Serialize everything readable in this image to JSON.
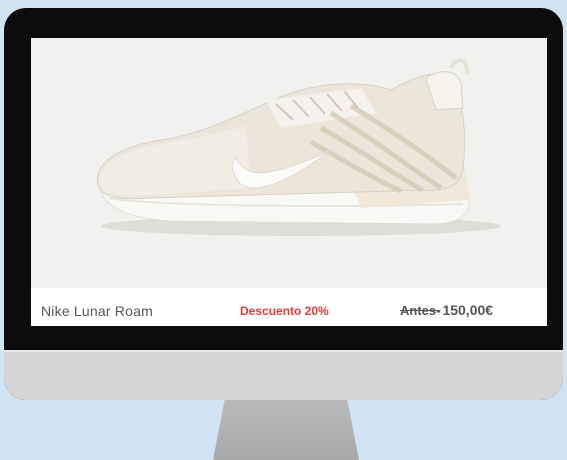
{
  "product": {
    "name": "Nike Lunar Roam",
    "discount_label": "Descuento 20%",
    "price_prefix": "Antes-",
    "price_value": "150,00€"
  },
  "colors": {
    "background": "#d2e3f3",
    "bezel": "#0c0c0c",
    "chin": "#d6d6d6",
    "stand": "#b0b0b0",
    "discount": "#e43a3a",
    "text": "#555555"
  },
  "icons": {
    "product_image": "sneaker-icon",
    "brand_logo": "swoosh-icon"
  }
}
